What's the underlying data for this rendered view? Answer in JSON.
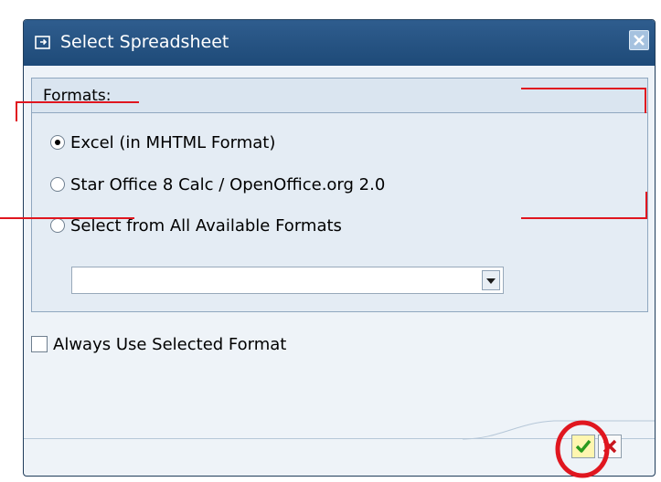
{
  "dialog": {
    "title": "Select Spreadsheet",
    "close_icon": "close-icon"
  },
  "formats": {
    "title": "Formats:",
    "options": [
      {
        "label": "Excel (in MHTML Format)",
        "selected": true
      },
      {
        "label": "Star Office 8 Calc / OpenOffice.org 2.0",
        "selected": false
      },
      {
        "label": "Select from All Available Formats",
        "selected": false
      }
    ],
    "dropdown_value": ""
  },
  "always_use": {
    "label": "Always Use Selected Format",
    "checked": false
  },
  "buttons": {
    "ok_icon": "checkmark-icon",
    "cancel_icon": "cancel-x-icon"
  },
  "colors": {
    "titlebar": "#2f5d8e",
    "annotation": "#e0161f"
  }
}
